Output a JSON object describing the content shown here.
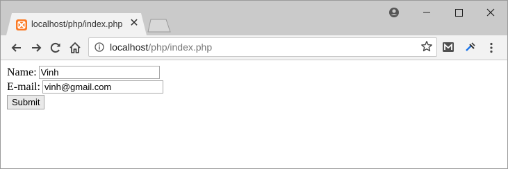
{
  "browser": {
    "tab": {
      "title": "localhost/php/index.php",
      "favicon": "xampp-icon",
      "close_glyph": "✕"
    },
    "address": {
      "host": "localhost",
      "path": "/php/index.php"
    },
    "controls": {
      "minimize": "minimize-icon",
      "maximize": "maximize-icon",
      "close": "close-icon"
    },
    "extensions": [
      "gmail-extension-icon",
      "tool-extension-icon"
    ],
    "accent": "#fb7a24"
  },
  "form": {
    "name_label": "Name:",
    "name_value": "Vinh",
    "email_label": "E-mail:",
    "email_value": "vinh@gmail.com",
    "submit_label": "Submit"
  }
}
